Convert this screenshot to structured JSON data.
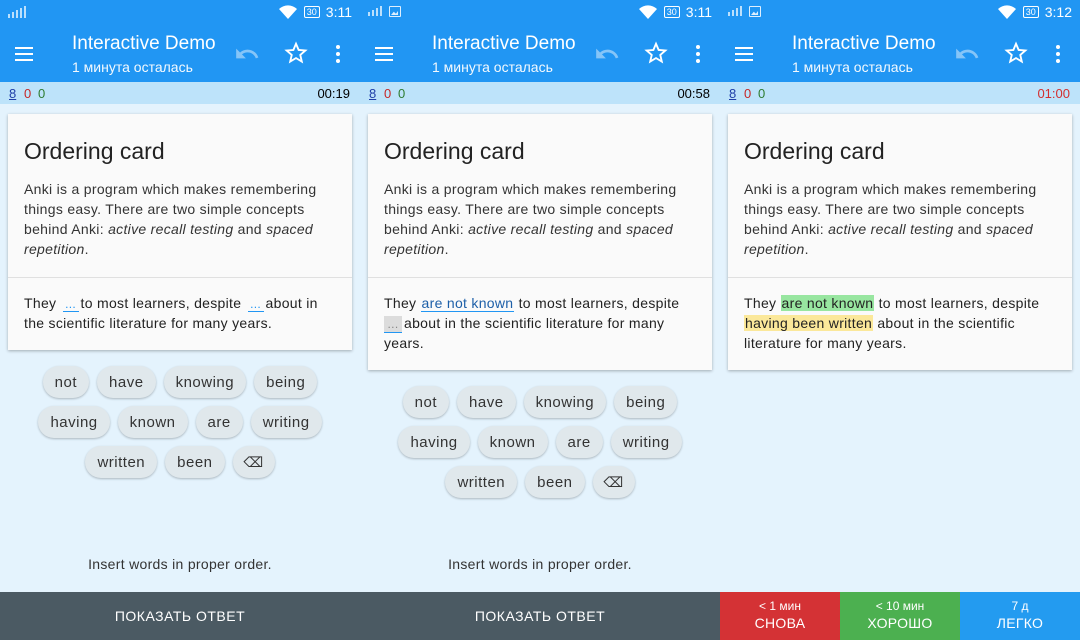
{
  "screens": [
    {
      "status": {
        "time": "3:11",
        "battery": "30"
      },
      "toolbar": {
        "title": "Interactive Demo",
        "subtitle": "1 минута осталась"
      },
      "counts": {
        "new": "8",
        "learning": "0",
        "review": "0"
      },
      "timer": "00:19",
      "card": {
        "title": "Ordering card",
        "text_before": "Anki is a program which makes remembering things easy. There are two simple concepts behind Anki: ",
        "italic1": "active recall testing",
        "and": " and ",
        "italic2": "spaced repetition",
        "end": ".",
        "cloze": {
          "w1": "They",
          "gap1": "...",
          "w2": "to most learners, despite",
          "gap2": "...",
          "w3": "about in the scientific literature for many years."
        }
      },
      "chips": [
        [
          "not",
          "have",
          "knowing",
          "being"
        ],
        [
          "having",
          "known",
          "are",
          "writing"
        ],
        [
          "written",
          "been",
          "⌫"
        ]
      ],
      "hint": "Insert words in proper order.",
      "show_answer": "ПОКАЗАТЬ ОТВЕТ"
    },
    {
      "status": {
        "time": "3:11",
        "battery": "30"
      },
      "toolbar": {
        "title": "Interactive Demo",
        "subtitle": "1 минута осталась"
      },
      "counts": {
        "new": "8",
        "learning": "0",
        "review": "0"
      },
      "timer": "00:58",
      "card": {
        "title": "Ordering card",
        "text_before": "Anki is a program which makes remembering things easy. There are two simple concepts behind Anki: ",
        "italic1": "active recall testing",
        "and": " and ",
        "italic2": "spaced repetition",
        "end": ".",
        "cloze": {
          "w1": "They",
          "gap1": "are not known",
          "w2": "to most learners, despite",
          "gap2": "...",
          "w3": "about in the scientific literature for many years."
        }
      },
      "chips": [
        [
          "not",
          "have",
          "knowing",
          "being"
        ],
        [
          "having",
          "known",
          "are",
          "writing"
        ],
        [
          "written",
          "been",
          "⌫"
        ]
      ],
      "hint": "Insert words in proper order.",
      "show_answer": "ПОКАЗАТЬ ОТВЕТ"
    },
    {
      "status": {
        "time": "3:12",
        "battery": "30"
      },
      "toolbar": {
        "title": "Interactive Demo",
        "subtitle": "1 минута осталась"
      },
      "counts": {
        "new": "8",
        "learning": "0",
        "review": "0"
      },
      "timer": "01:00",
      "card": {
        "title": "Ordering card",
        "text_before": "Anki is a program which makes remembering things easy. There are two simple concepts behind Anki: ",
        "italic1": "active recall testing",
        "and": " and ",
        "italic2": "spaced repetition",
        "end": ".",
        "cloze": {
          "w1": "They",
          "gap1": "are not known",
          "w2": "to most learners, despite",
          "gap2": "having been written",
          "w3": "about in the scientific literature for many years."
        }
      },
      "answers": [
        {
          "interval": "< 1 мин",
          "label": "СНОВА"
        },
        {
          "interval": "< 10 мин",
          "label": "ХОРОШО"
        },
        {
          "interval": "7 д",
          "label": "ЛЕГКО"
        }
      ]
    }
  ],
  "colors": {
    "primary": "#2196f3",
    "count_bar": "#bde3fa",
    "background": "#e4f3fd",
    "again": "#d43235",
    "good": "#4cb050",
    "easy": "#239bf0",
    "timer_overdue": "#d32f2f"
  }
}
